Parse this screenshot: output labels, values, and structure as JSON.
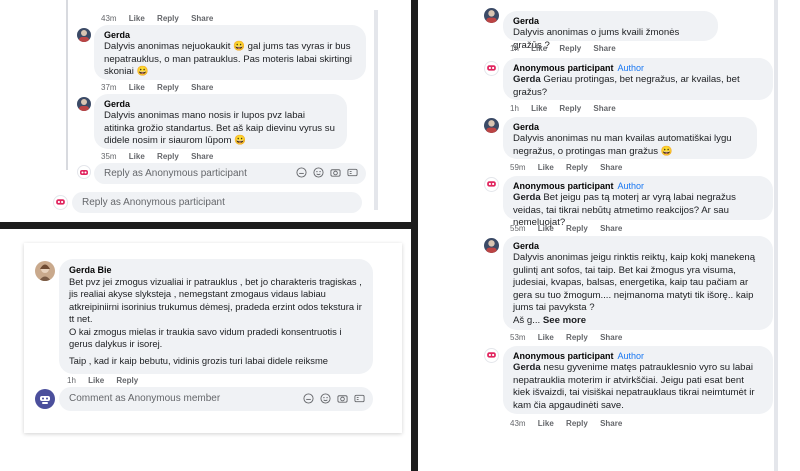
{
  "panel_a": {
    "top_actions": {
      "time": "43m",
      "like": "Like",
      "reply": "Reply",
      "share": "Share"
    },
    "c1": {
      "author": "Gerda",
      "text": "Dalyvis anonimas nejuokaukit 😀 gal jums tas vyras ir bus nepatrauklus, o man patrauklus. Pas moteris labai skirtingi skoniai 😀",
      "time": "37m",
      "like": "Like",
      "reply": "Reply",
      "share": "Share"
    },
    "c2": {
      "author": "Gerda",
      "text": "Dalyvis anonimas mano nosis ir lupos pvz labai atitinka grožio standartus. Bet aš kaip dievinu vyrus su didele nosim ir siaurom lūpom 😀",
      "time": "35m",
      "like": "Like",
      "reply": "Reply",
      "share": "Share"
    },
    "reply_inner": "Reply as Anonymous participant",
    "reply_outer": "Reply as Anonymous participant"
  },
  "panel_b": {
    "c1": {
      "author": "Gerda Bie",
      "lines": [
        "Bet pvz jei zmogus vizualiai ir patrauklus , bet jo charakteris tragiskas ,",
        "jis realiai akyse slyksteja , nemegstant zmogaus vidaus labiau",
        "atkreipiniirni isorinius trukumus dėmesį, pradeda erzint odos tekstura ir",
        "tt net.",
        "O kai zmogus mielas ir traukia savo vidum pradedi konsentruotis i",
        "gerus dalykus ir isorej.",
        "Taip , kad ir kaip bebutu, vidinis grozis turi labai didele reiksme"
      ],
      "time": "1h",
      "like": "Like",
      "reply": "Reply"
    },
    "comment_placeholder": "Comment as Anonymous member"
  },
  "panel_c": {
    "c1": {
      "author": "Gerda",
      "text": "Dalyvis anonimas o jums kvaili žmonės gražūs ?",
      "time": "1h",
      "like": "Like",
      "reply": "Reply",
      "share": "Share"
    },
    "c2": {
      "author": "Anonymous participant",
      "tag": "Author",
      "mention": "Gerda",
      "text": " Geriau protingas, bet negražus, ar kvailas, bet gražus?",
      "time": "1h",
      "like": "Like",
      "reply": "Reply",
      "share": "Share"
    },
    "c3": {
      "author": "Gerda",
      "text": "Dalyvis anonimas nu man kvailas automatiškai lygu negražus, o protingas man gražus 😀",
      "time": "59m",
      "like": "Like",
      "reply": "Reply",
      "share": "Share"
    },
    "c4": {
      "author": "Anonymous participant",
      "tag": "Author",
      "mention": "Gerda",
      "text": " Bet jeigu pas tą moterį ar vyrą labai negražus veidas, tai tikrai nebūtų atmetimo reakcijos? Ar sau nemeluojat?",
      "time": "55m",
      "like": "Like",
      "reply": "Reply",
      "share": "Share"
    },
    "c5": {
      "author": "Gerda",
      "text": "Dalyvis anonimas jeigu rinktis reiktų, kaip kokį manekeną gulintį ant sofos, tai taip. Bet kai žmogus yra visuma, judesiai, kvapas, balsas, energetika, kaip tau pačiam ar gera su tuo žmogum.... neįmanoma matyti tik išorę.. kaip jums tai pavyksta ?",
      "more_prefix": "Aš g...",
      "see_more": "See more",
      "time": "53m",
      "like": "Like",
      "reply": "Reply",
      "share": "Share"
    },
    "c6": {
      "author": "Anonymous participant",
      "tag": "Author",
      "mention": "Gerda",
      "text": " nesu gyvenime matęs patrauklesnio vyro su labai nepatrauklia moterim ir atvirkščiai. Jeigu pati esat bent kiek išvaizdi, tai visiškai nepatrauklaus tikrai neimtumėt ir kam čia apgaudinėti save.",
      "time": "43m",
      "like": "Like",
      "reply": "Reply",
      "share": "Share"
    }
  },
  "colors": {
    "bubble": "#f0f2f5",
    "author_tag": "#1877f2",
    "meta": "#65676b",
    "divider": "#1c1c1c"
  }
}
